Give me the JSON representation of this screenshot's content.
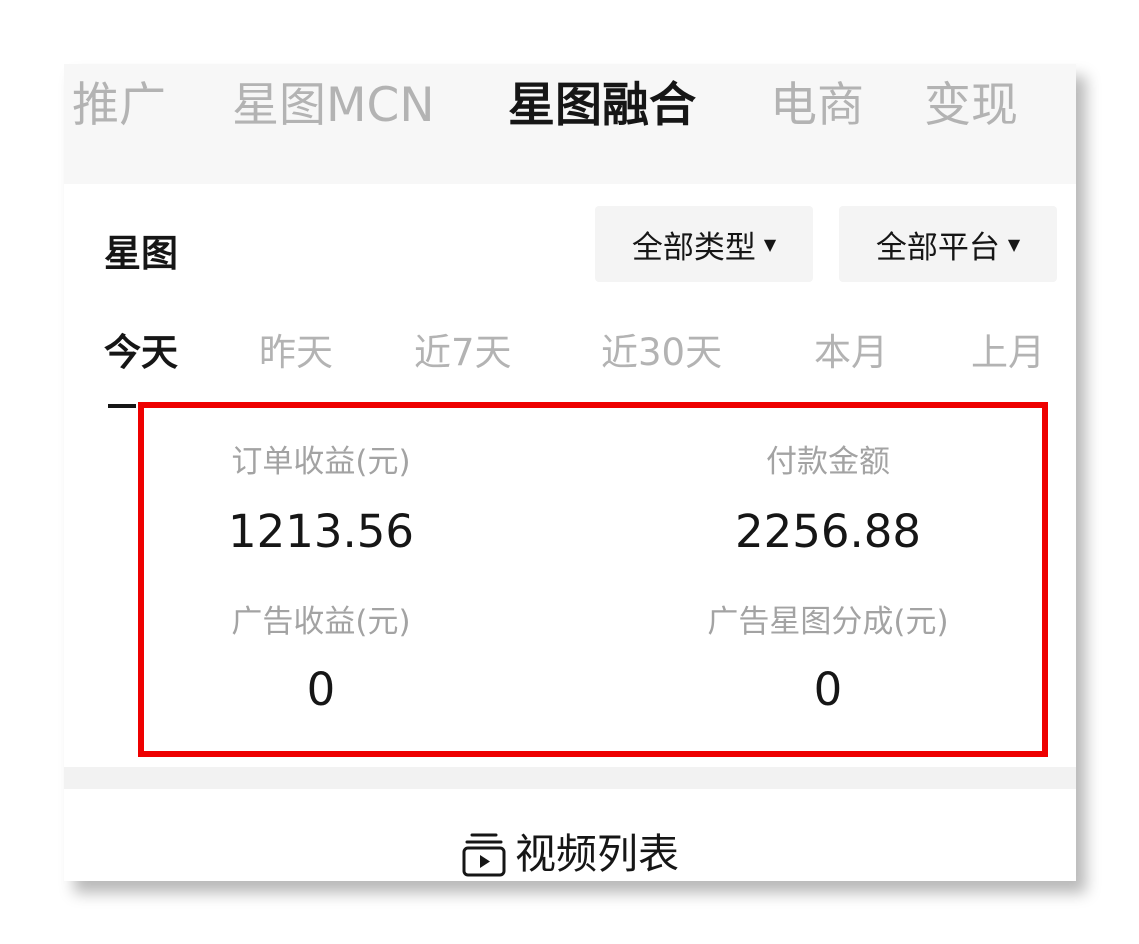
{
  "top_tabs": [
    {
      "label": "推广",
      "active": false
    },
    {
      "label": "星图MCN",
      "active": false
    },
    {
      "label": "星图融合",
      "active": true
    },
    {
      "label": "电商",
      "active": false
    },
    {
      "label": "变现",
      "active": false
    }
  ],
  "section": {
    "title": "星图",
    "filters": [
      {
        "label": "全部类型",
        "icon": "caret-down-icon"
      },
      {
        "label": "全部平台",
        "icon": "caret-down-icon"
      }
    ]
  },
  "periods": [
    {
      "label": "今天",
      "active": true
    },
    {
      "label": "昨天",
      "active": false
    },
    {
      "label": "近7天",
      "active": false
    },
    {
      "label": "近30天",
      "active": false
    },
    {
      "label": "本月",
      "active": false
    },
    {
      "label": "上月",
      "active": false
    }
  ],
  "metrics": [
    {
      "label": "订单收益(元)",
      "value": "1213.56"
    },
    {
      "label": "付款金额",
      "value": "2256.88"
    },
    {
      "label": "广告收益(元)",
      "value": "0"
    },
    {
      "label": "广告星图分成(元)",
      "value": "0"
    }
  ],
  "highlight_color": "#ee0000",
  "video_list": {
    "label": "视频列表",
    "icon": "video-list-icon"
  }
}
